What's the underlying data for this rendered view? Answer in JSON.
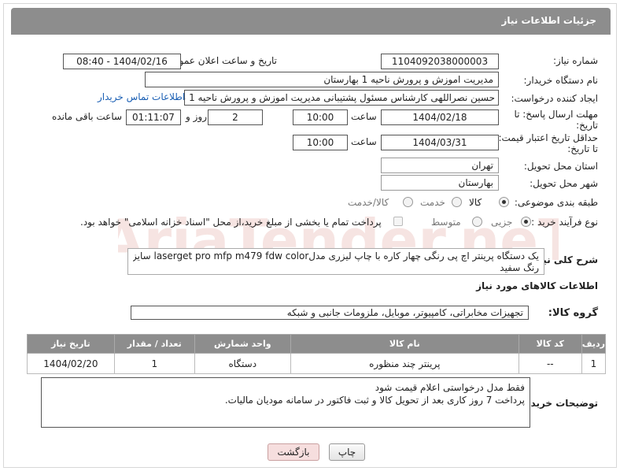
{
  "header": {
    "title": "جزئیات اطلاعات نیاز"
  },
  "need_number": {
    "label": "شماره نیاز:",
    "value": "1104092038000003"
  },
  "announce_datetime": {
    "label": "تاریخ و ساعت اعلان عمومی:",
    "value": "1404/02/16 - 08:40"
  },
  "buyer_org": {
    "label": "نام دستگاه خریدار:",
    "value": "مدیریت اموزش و پرورش ناحیه 1 بهارستان"
  },
  "requester": {
    "label": "ایجاد کننده درخواست:",
    "value": "حسین نصراللهی کارشناس مسئول پشتیبانی مدیریت اموزش و پرورش ناحیه 1 بهارستان",
    "contact_link": "اطلاعات تماس خریدار"
  },
  "reply_deadline": {
    "label_line1": "مهلت ارسال پاسخ: تا",
    "label_line2": "تاریخ:",
    "date": "1404/02/18",
    "time_label": "ساعت",
    "time": "10:00",
    "days": "2",
    "days_label": "روز و",
    "remaining": "01:11:07",
    "remaining_label": "ساعت باقی مانده"
  },
  "price_validity": {
    "label_line1": "حداقل تاریخ اعتبار قیمت:",
    "label_line2": "تا تاریخ:",
    "date": "1404/03/31",
    "time_label": "ساعت",
    "time": "10:00"
  },
  "delivery_province": {
    "label": "استان محل تحویل:",
    "value": "تهران"
  },
  "delivery_city": {
    "label": "شهر محل تحویل:",
    "value": "بهارستان"
  },
  "category": {
    "label": "طبقه بندی موضوعی:",
    "options": [
      "کالا",
      "خدمت",
      "کالا/خدمت"
    ],
    "selected": "کالا"
  },
  "purchase_process": {
    "label": "نوع فرآیند خرید :",
    "options": [
      "جزیی",
      "متوسط"
    ],
    "selected": "جزیی",
    "note": "پرداخت تمام یا بخشی از مبلغ خرید،از محل \"اسناد خزانه اسلامی\" خواهد بود."
  },
  "description": {
    "label": "شرح کلی نیاز:",
    "line1": "یک دستگاه پرینتر اچ پی رنگی چهار کاره با چاپ لیزری مدلlaserget pro mfp m479 fdw color سایز چاپ a4",
    "line2": "رنگ سفید"
  },
  "goods_section": {
    "title": "اطلاعات کالاهای مورد نیاز"
  },
  "goods_group": {
    "label": "گروه کالا:",
    "value": "تجهیزات مخابراتی، کامپیوتر، موبایل، ملزومات جانبی و شبکه"
  },
  "table": {
    "headers": [
      "ردیف",
      "کد کالا",
      "نام کالا",
      "واحد شمارش",
      "تعداد / مقدار",
      "تاریخ نیاز"
    ],
    "rows": [
      [
        "1",
        "--",
        "پرینتر چند منظوره",
        "دستگاه",
        "1",
        "1404/02/20"
      ]
    ]
  },
  "buyer_notes": {
    "label": "توضیحات خریدار:",
    "line1": "فقط مدل درخواستی اعلام قیمت شود",
    "line2": "پرداخت 7 روز کاری بعد از تحویل کالا و ثبت فاکتور در سامانه مودیان مالیات."
  },
  "buttons": {
    "print": "چاپ",
    "back": "بازگشت"
  },
  "watermark": "AriaTender.neT"
}
